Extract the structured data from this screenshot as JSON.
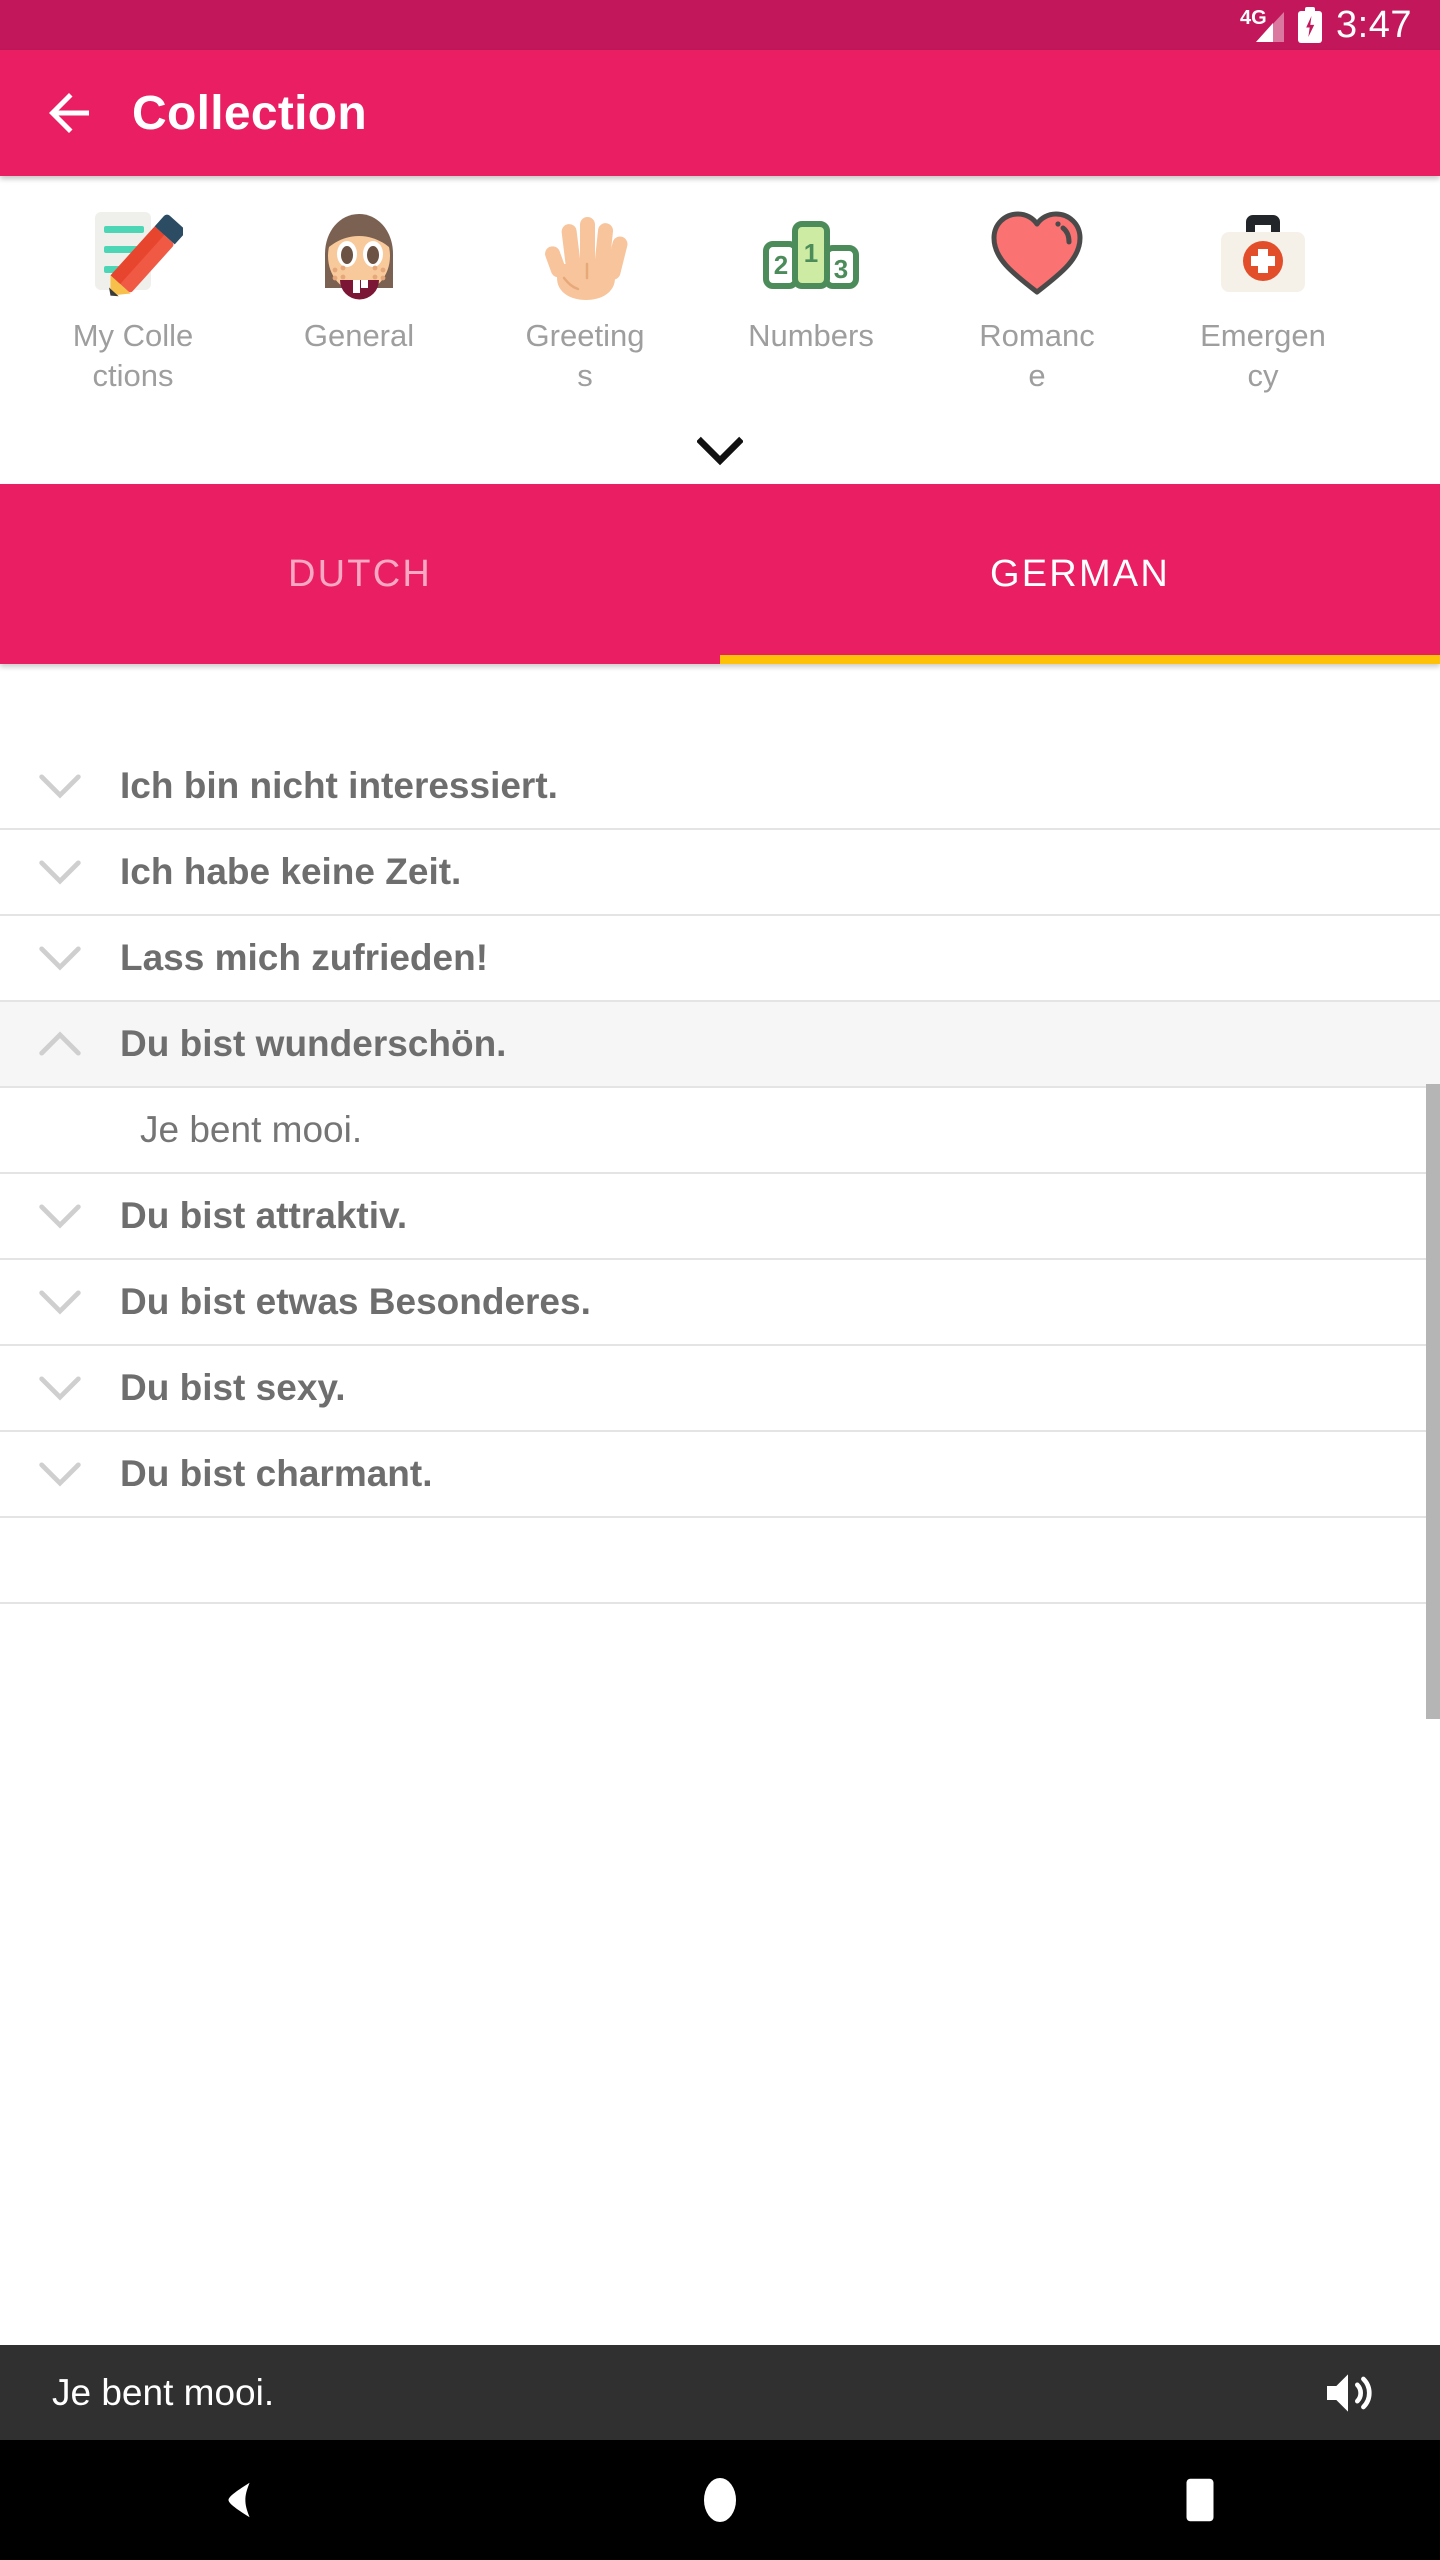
{
  "status_bar": {
    "network": "4G",
    "time": "3:47",
    "battery_icon": "battery-charging-icon",
    "signal_icon": "signal-4g-icon"
  },
  "app_bar": {
    "back_icon": "back-arrow-icon",
    "title": "Collection"
  },
  "categories": {
    "expand_icon": "chevron-down-icon",
    "items": [
      {
        "label": "My Collections",
        "icon": "memo-pencil-icon"
      },
      {
        "label": "General",
        "icon": "face-emoji-icon"
      },
      {
        "label": "Greetings",
        "icon": "raised-hand-icon"
      },
      {
        "label": "Numbers",
        "icon": "podium-123-icon"
      },
      {
        "label": "Romance",
        "icon": "heart-icon"
      },
      {
        "label": "Emergency",
        "icon": "first-aid-kit-icon"
      }
    ]
  },
  "tabs": {
    "items": [
      {
        "label": "DUTCH",
        "active": false
      },
      {
        "label": "GERMAN",
        "active": true
      }
    ],
    "indicator_color": "#FFC107"
  },
  "phrases": [
    {
      "text": "Ich bin nicht interessiert.",
      "expanded": false,
      "chevron": "chevron-down-icon"
    },
    {
      "text": "Ich habe keine Zeit.",
      "expanded": false,
      "chevron": "chevron-down-icon"
    },
    {
      "text": "Lass mich zufrieden!",
      "expanded": false,
      "chevron": "chevron-down-icon"
    },
    {
      "text": "Du bist wunderschön.",
      "expanded": true,
      "chevron": "chevron-up-icon",
      "translation": "Je bent mooi."
    },
    {
      "text": "Du bist attraktiv.",
      "expanded": false,
      "chevron": "chevron-down-icon"
    },
    {
      "text": "Du bist etwas Besonderes.",
      "expanded": false,
      "chevron": "chevron-down-icon"
    },
    {
      "text": "Du bist sexy.",
      "expanded": false,
      "chevron": "chevron-down-icon"
    },
    {
      "text": "Du bist charmant.",
      "expanded": false,
      "chevron": "chevron-down-icon"
    }
  ],
  "player": {
    "text": "Je bent mooi.",
    "speaker_icon": "speaker-volume-icon"
  },
  "nav_bar": {
    "back_icon": "nav-back-triangle-icon",
    "home_icon": "nav-home-circle-icon",
    "recents_icon": "nav-recents-square-icon"
  },
  "colors": {
    "status_bar": "#C2185B",
    "app_bar": "#E91E63",
    "tab_bar": "#E91E63",
    "accent": "#FFC107",
    "player_bg": "#303030",
    "nav_bg": "#000000",
    "row_text": "#6E6E6E"
  }
}
